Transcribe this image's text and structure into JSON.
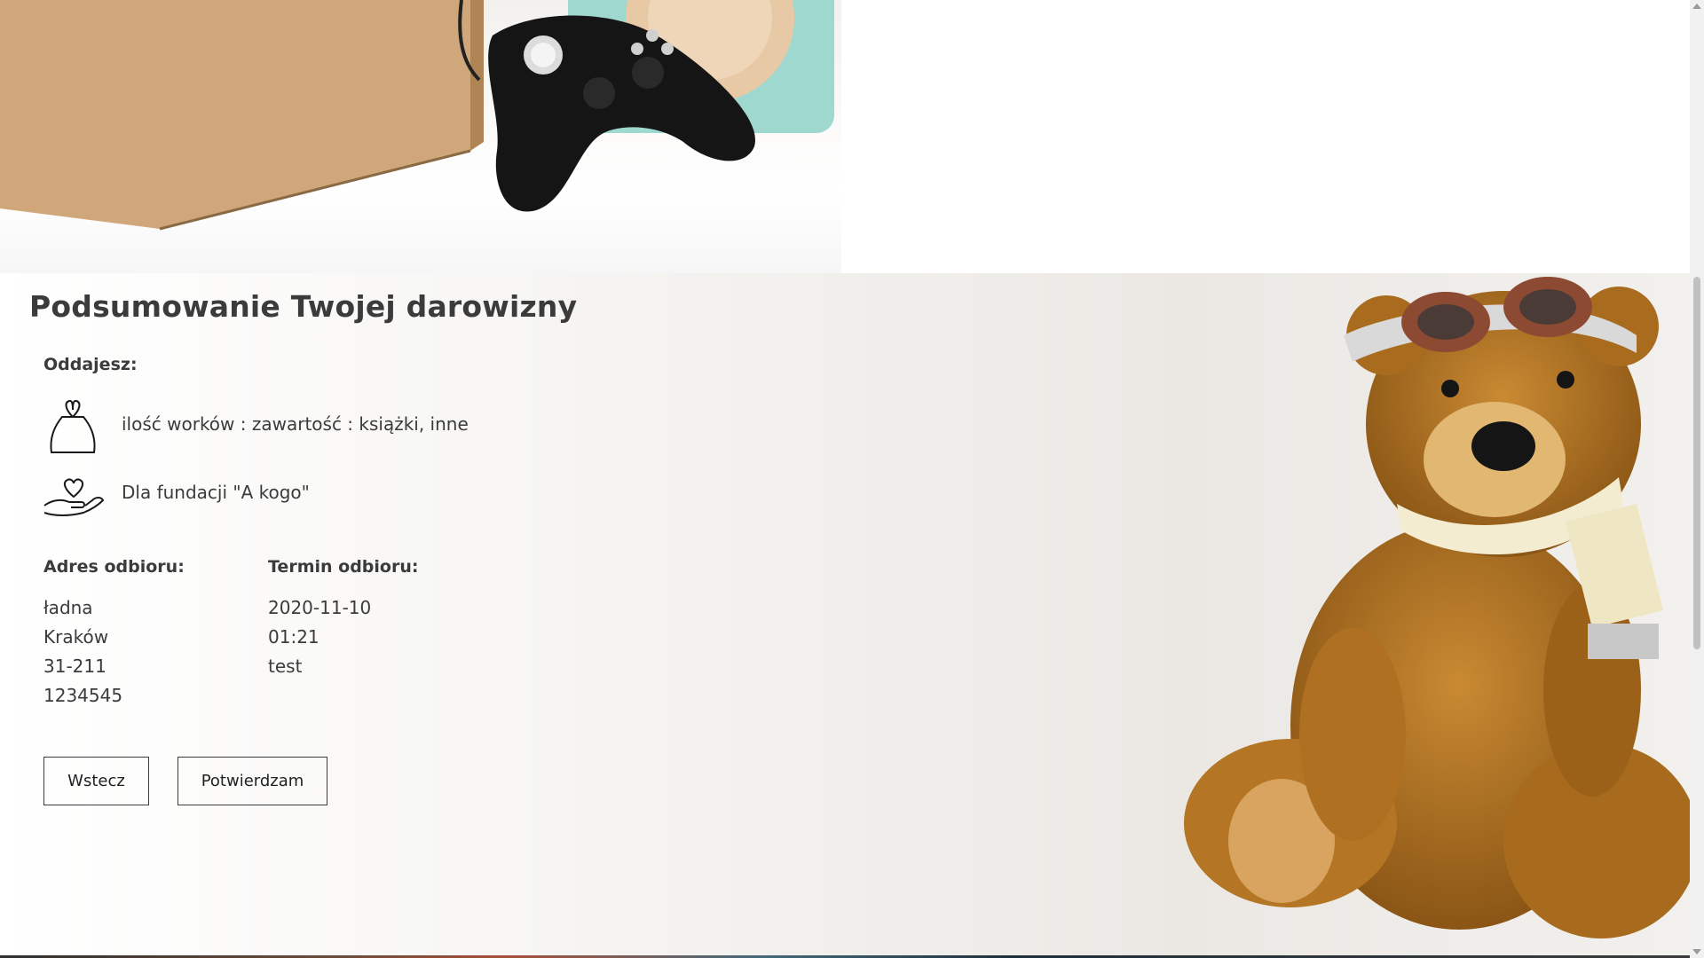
{
  "summary": {
    "title": "Podsumowanie Twojej darowizny",
    "giving_label": "Oddajesz:",
    "bags_text": "ilość worków : zawartość : książki, inne",
    "foundation_text": "Dla fundacji \"A kogo\"",
    "address_heading": "Adres odbioru:",
    "address_lines": [
      "ładna",
      "Kraków",
      "31-211",
      "1234545"
    ],
    "date_heading": "Termin odbioru:",
    "date_lines": [
      "2020-11-10",
      "01:21",
      "test"
    ]
  },
  "buttons": {
    "back_label": "Wstecz",
    "confirm_label": "Potwierdzam"
  },
  "icons": {
    "bag": "bag-icon",
    "hand_heart": "hand-heart-icon"
  },
  "colors": {
    "text": "#3b3b3b",
    "button_border": "#3b3b3b"
  }
}
